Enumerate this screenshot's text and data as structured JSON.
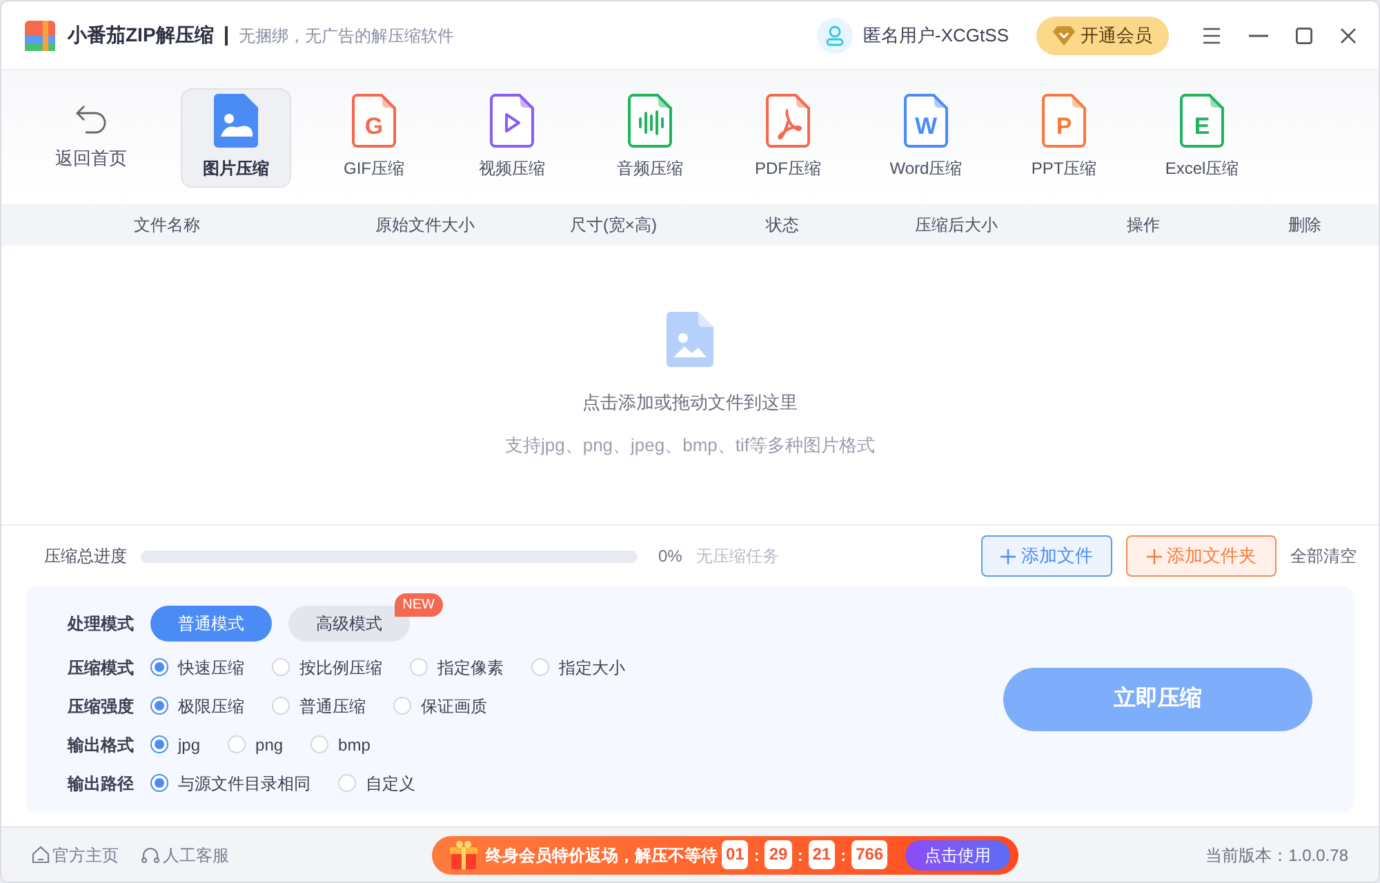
{
  "app": {
    "title": "小番茄ZIP解压缩",
    "slogan": "无捆绑，无广告的解压缩软件"
  },
  "user": {
    "name": "匿名用户-XCGtSS"
  },
  "vip_button": "开通会员",
  "back": {
    "label": "返回首页"
  },
  "tools": [
    {
      "label": "图片压缩",
      "kind": "image",
      "color": "#4b8bf5",
      "selected": true
    },
    {
      "label": "GIF压缩",
      "kind": "letter",
      "glyph": "G",
      "color": "#f5694f",
      "selected": false
    },
    {
      "label": "视频压缩",
      "kind": "video",
      "color": "#8b5cf6",
      "selected": false
    },
    {
      "label": "音频压缩",
      "kind": "audio",
      "color": "#22b35e",
      "selected": false
    },
    {
      "label": "PDF压缩",
      "kind": "pdf",
      "color": "#f5694f",
      "selected": false
    },
    {
      "label": "Word压缩",
      "kind": "letter",
      "glyph": "W",
      "color": "#4b8bf5",
      "selected": false
    },
    {
      "label": "PPT压缩",
      "kind": "letter",
      "glyph": "P",
      "color": "#f97a3c",
      "selected": false
    },
    {
      "label": "Excel压缩",
      "kind": "letter",
      "glyph": "E",
      "color": "#22b35e",
      "selected": false
    }
  ],
  "table": {
    "columns": [
      "文件名称",
      "原始文件大小",
      "尺寸(宽×高)",
      "状态",
      "压缩后大小",
      "操作",
      "删除"
    ]
  },
  "dropzone": {
    "title": "点击添加或拖动文件到这里",
    "hint": "支持jpg、png、jpeg、bmp、tif等多种图片格式"
  },
  "progress": {
    "label": "压缩总进度",
    "level": 0,
    "reading": "0%",
    "status": "无压缩任务"
  },
  "actions": {
    "add_file": "添加文件",
    "add_folder": "添加文件夹",
    "clear_all": "全部清空"
  },
  "settings": [
    {
      "label": "处理模式",
      "kind": "segmented",
      "options": [
        {
          "label": "普通模式",
          "selected": true
        },
        {
          "label": "高级模式",
          "selected": false,
          "badge": "NEW"
        }
      ]
    },
    {
      "label": "压缩模式",
      "kind": "radio",
      "options": [
        {
          "label": "快速压缩",
          "selected": true
        },
        {
          "label": "按比例压缩",
          "selected": false
        },
        {
          "label": "指定像素",
          "selected": false
        },
        {
          "label": "指定大小",
          "selected": false
        }
      ]
    },
    {
      "label": "压缩强度",
      "kind": "radio",
      "options": [
        {
          "label": "极限压缩",
          "selected": true
        },
        {
          "label": "普通压缩",
          "selected": false
        },
        {
          "label": "保证画质",
          "selected": false
        }
      ]
    },
    {
      "label": "输出格式",
      "kind": "radio",
      "options": [
        {
          "label": "jpg",
          "selected": true
        },
        {
          "label": "png",
          "selected": false
        },
        {
          "label": "bmp",
          "selected": false
        }
      ]
    },
    {
      "label": "输出路径",
      "kind": "radio",
      "options": [
        {
          "label": "与源文件目录相同",
          "selected": true
        },
        {
          "label": "自定义",
          "selected": false
        }
      ]
    }
  ],
  "compress_button": "立即压缩",
  "footer": {
    "links": [
      {
        "label": "官方主页",
        "kind": "home"
      },
      {
        "label": "人工客服",
        "kind": "headset"
      }
    ],
    "promo": {
      "text": "终身会员特价返场，解压不等待",
      "countdown": [
        "01",
        "29",
        "21",
        "766"
      ],
      "separator": ":",
      "cta": "点击使用"
    },
    "version": "当前版本：1.0.0.78"
  }
}
